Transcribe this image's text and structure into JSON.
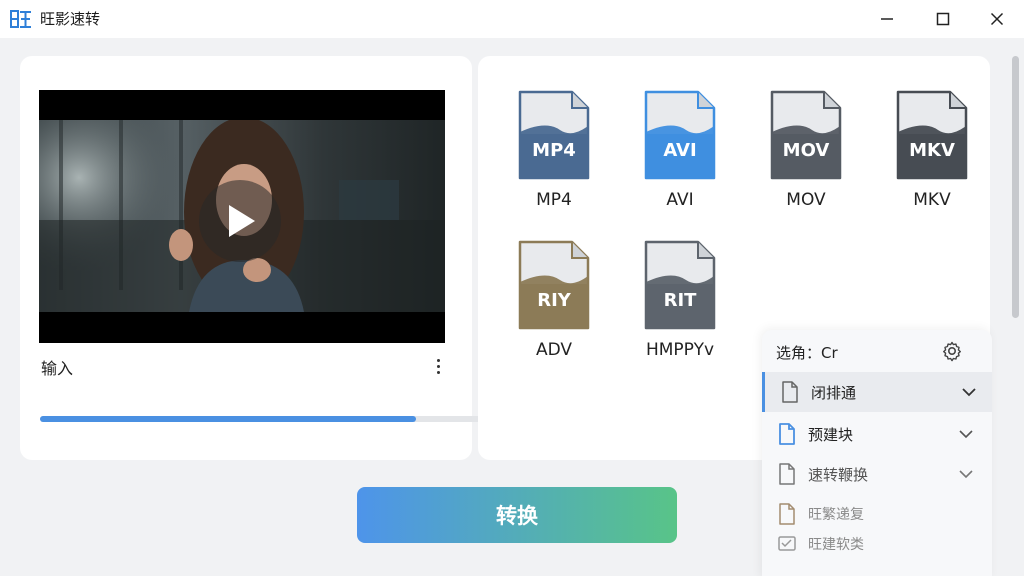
{
  "window": {
    "logo_text": "旺",
    "title": "旺影速转"
  },
  "preview": {
    "label": "输入",
    "progress_fraction": 0.55
  },
  "formats": [
    {
      "tag": "MP4",
      "caption": "MP4",
      "color": "#4a6a92"
    },
    {
      "tag": "AVI",
      "caption": "AVI",
      "color": "#3f8fe0"
    },
    {
      "tag": "MOV",
      "caption": "MOV",
      "color": "#555b63"
    },
    {
      "tag": "MKV",
      "caption": "MKV",
      "color": "#474c53"
    },
    {
      "tag": "RIY",
      "caption": "ADV",
      "color": "#8c7b57"
    },
    {
      "tag": "RIT",
      "caption": "HMPPYv",
      "color": "#5d646d"
    }
  ],
  "panel": {
    "header": "选角：Cr",
    "items": [
      {
        "label": "闭排通"
      },
      {
        "label": "预建块"
      },
      {
        "label": "速转鞭换"
      },
      {
        "label": "旺繁递复"
      },
      {
        "label": "旺建软类"
      }
    ]
  },
  "actions": {
    "convert_label": "转换"
  },
  "colors": {
    "accent": "#4a90e2",
    "accent_green": "#58c488"
  }
}
